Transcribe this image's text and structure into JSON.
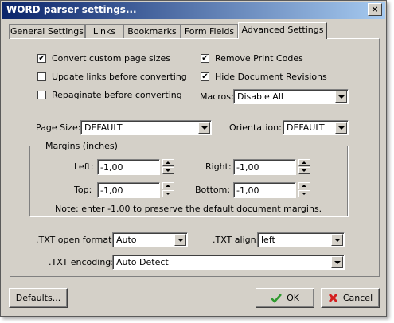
{
  "window": {
    "title": "WORD parser settings...",
    "close_glyph": "×"
  },
  "tabs": [
    {
      "label": "General Settings"
    },
    {
      "label": "Links"
    },
    {
      "label": "Bookmarks"
    },
    {
      "label": "Form Fields"
    },
    {
      "label": "Advanced Settings",
      "active": true
    }
  ],
  "options": {
    "convert_custom_page_sizes": {
      "label": "Convert custom page sizes",
      "checked": true
    },
    "update_links": {
      "label": "Update links before converting",
      "checked": false
    },
    "repaginate": {
      "label": "Repaginate before converting",
      "checked": false
    },
    "remove_print_codes": {
      "label": "Remove Print Codes",
      "checked": true
    },
    "hide_revisions": {
      "label": "Hide Document Revisions",
      "checked": true
    }
  },
  "check_glyph": "✔",
  "macros": {
    "label": "Macros:",
    "value": "Disable All"
  },
  "page_size": {
    "label": "Page Size:",
    "value": "DEFAULT"
  },
  "orientation": {
    "label": "Orientation:",
    "value": "DEFAULT"
  },
  "margins": {
    "title": "Margins (inches)",
    "left": {
      "label": "Left:",
      "value": "-1,00"
    },
    "right": {
      "label": "Right:",
      "value": "-1,00"
    },
    "top": {
      "label": "Top:",
      "value": "-1,00"
    },
    "bottom": {
      "label": "Bottom:",
      "value": "-1,00"
    },
    "note": "Note: enter -1.00 to preserve the default document margins."
  },
  "txt": {
    "open_format": {
      "label": ".TXT open format:",
      "value": "Auto"
    },
    "align": {
      "label": ".TXT align:",
      "value": "left"
    },
    "encoding": {
      "label": ".TXT encoding:",
      "value": "Auto Detect"
    }
  },
  "buttons": {
    "defaults": "Defaults...",
    "ok": "OK",
    "cancel": "Cancel"
  },
  "colors": {
    "title_start": "#0a246a",
    "title_end": "#a6caf0",
    "ok_icon": "#2e9a2e",
    "cancel_icon": "#d42020"
  }
}
